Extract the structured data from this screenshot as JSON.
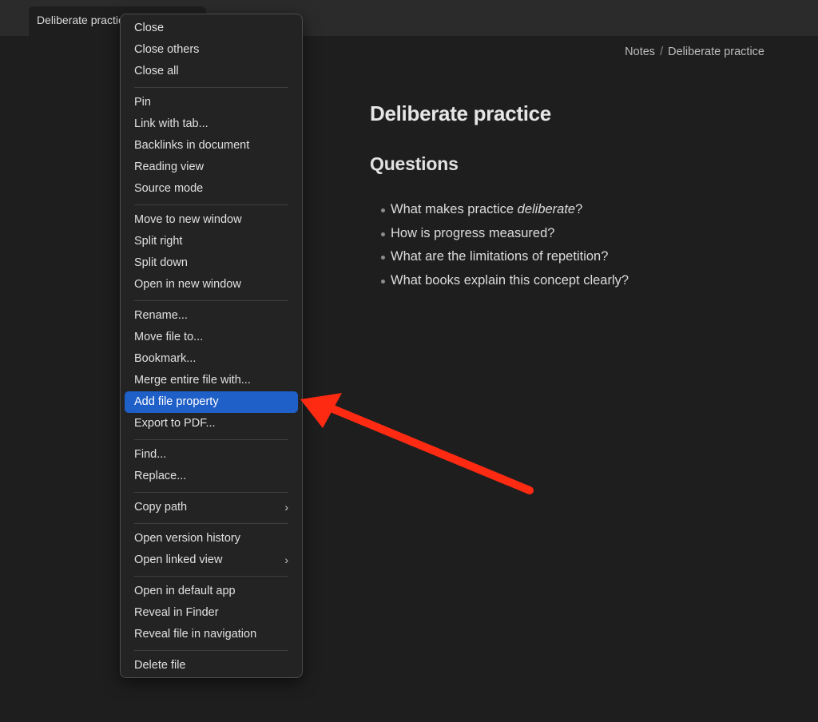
{
  "tab": {
    "title": "Deliberate practice"
  },
  "breadcrumb": {
    "parent": "Notes",
    "separator": "/",
    "current": "Deliberate practice"
  },
  "note": {
    "title": "Deliberate practice",
    "heading": "Questions",
    "bullets": {
      "b1_prefix": "What makes practice ",
      "b1_emph": "deliberate",
      "b1_suffix": "?",
      "b2": "How is progress measured?",
      "b3": "What are the limitations of repetition?",
      "b4": "What books explain this concept clearly?"
    }
  },
  "menu": {
    "close": "Close",
    "close_others": "Close others",
    "close_all": "Close all",
    "pin": "Pin",
    "link_with_tab": "Link with tab...",
    "backlinks": "Backlinks in document",
    "reading_view": "Reading view",
    "source_mode": "Source mode",
    "move_new_window": "Move to new window",
    "split_right": "Split right",
    "split_down": "Split down",
    "open_new_window": "Open in new window",
    "rename": "Rename...",
    "move_file": "Move file to...",
    "bookmark": "Bookmark...",
    "merge": "Merge entire file with...",
    "add_property": "Add file property",
    "export_pdf": "Export to PDF...",
    "find": "Find...",
    "replace": "Replace...",
    "copy_path": "Copy path",
    "version_history": "Open version history",
    "linked_view": "Open linked view",
    "default_app": "Open in default app",
    "reveal_finder": "Reveal in Finder",
    "reveal_nav": "Reveal file in navigation",
    "delete": "Delete file",
    "chevron_glyph": "›"
  },
  "colors": {
    "background": "#1e1e1e",
    "menu_background": "#232323",
    "highlight": "#1f5fc8",
    "annotation_arrow": "#ff2a12"
  },
  "icons": {
    "submenu": "chevron-right-icon"
  }
}
